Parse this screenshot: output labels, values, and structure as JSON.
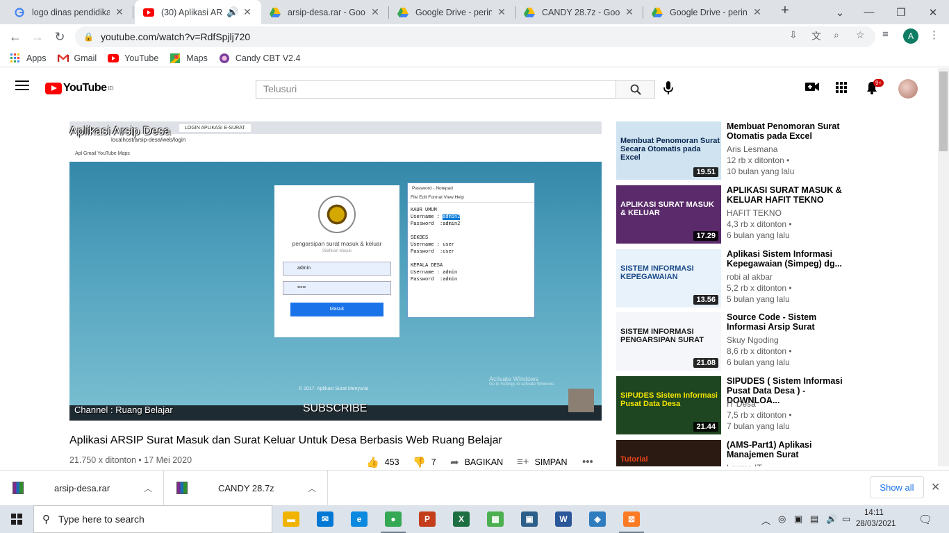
{
  "chrome": {
    "tabs": [
      {
        "title": "logo dinas pendidikan",
        "icon": "google-g-icon",
        "color": "#4285f4"
      },
      {
        "title": "(30) Aplikasi ARSIP",
        "icon": "youtube-icon",
        "color": "#ff0000",
        "active": true
      },
      {
        "title": "arsip-desa.rar - Google",
        "icon": "google-drive-icon",
        "color": "#fbbc04"
      },
      {
        "title": "Google Drive - peringk",
        "icon": "google-drive-icon",
        "color": "#fbbc04"
      },
      {
        "title": "CANDY 28.7z - Google",
        "icon": "google-drive-icon",
        "color": "#fbbc04"
      },
      {
        "title": "Google Drive - peringk",
        "icon": "google-drive-icon",
        "color": "#fbbc04"
      }
    ],
    "url": "youtube.com/watch?v=RdfSpjlj720",
    "profile_initial": "A",
    "bookmarks": [
      {
        "label": "Apps",
        "icon": "apps-grid-icon"
      },
      {
        "label": "Gmail",
        "icon": "gmail-icon"
      },
      {
        "label": "YouTube",
        "icon": "youtube-icon"
      },
      {
        "label": "Maps",
        "icon": "maps-icon"
      },
      {
        "label": "Candy CBT V2.4",
        "icon": "candy-icon"
      }
    ]
  },
  "youtube": {
    "logo_text": "YouTube",
    "logo_region": "ID",
    "search_placeholder": "Telusuri",
    "notif_count": "9+"
  },
  "player": {
    "overlay_title": "Aplikasi Arsip Desa",
    "inner_tab_title": "LOGIN APLIKASI E-SURAT",
    "inner_url": "localhost/arsip-desa/web/login",
    "inner_bookmarks": "Apl   Gmail   YouTube   Maps",
    "login_heading": "pengarsipan surat masuk & keluar",
    "login_sub": "Silahkan Masuk",
    "login_user": "admin",
    "login_pass": "•••••",
    "login_button": "Masuk",
    "notepad_title": "Password - Notepad",
    "notepad_menu": "File   Edit   Format   View   Help",
    "notepad_lines_before": "KAUR UMUM\nUsername : ",
    "notepad_highlight": "admin2",
    "notepad_lines_after": "\nPassword  :admin2\n\nSEKDES\nUsername : user\nPassword  :user\n\nKEPALA DESA\nUsername : admin\nPassword  :admin",
    "footer": "© 2017. Aplikasi Surat Menyurat",
    "activate_title": "Activate Windows",
    "activate_sub": "Go to Settings to activate Windows.",
    "channel": "Channel : Ruang Belajar",
    "subscribe": "SUBSCRIBE"
  },
  "video": {
    "title": "Aplikasi ARSIP Surat Masuk dan Surat Keluar Untuk Desa Berbasis Web Ruang Belajar",
    "meta": "21.750 x ditonton • 17 Mei 2020",
    "likes": "453",
    "dislikes": "7",
    "share": "BAGIKAN",
    "save": "SIMPAN"
  },
  "recommendations": [
    {
      "title": "Membuat Penomoran Surat Otomatis pada Excel",
      "channel": "Aris Lesmana",
      "views": "12 rb x ditonton •",
      "age": "10 bulan yang lalu",
      "duration": "19.51",
      "thumb_text": "Membuat Penomoran Surat Secara Otomatis pada Excel",
      "thumb_bg": "#cfe3f0",
      "thumb_fg": "#0d2a55"
    },
    {
      "title": "APLIKASI SURAT MASUK & KELUAR HAFIT TEKNO",
      "channel": "HAFIT TEKNO",
      "views": "4,3 rb x ditonton •",
      "age": "6 bulan yang lalu",
      "duration": "17.29",
      "thumb_text": "APLIKASI SURAT MASUK & KELUAR",
      "thumb_bg": "#5a2a6a",
      "thumb_fg": "#ffffff"
    },
    {
      "title": "Aplikasi Sistem Informasi Kepegawaian (Simpeg) dg...",
      "channel": "robi al akbar",
      "views": "5,2 rb x ditonton •",
      "age": "5 bulan yang lalu",
      "duration": "13.56",
      "thumb_text": "SISTEM INFORMASI KEPEGAWAIAN",
      "thumb_bg": "#e8f2fa",
      "thumb_fg": "#1a4a8a"
    },
    {
      "title": "Source Code - Sistem Informasi Arsip Surat",
      "channel": "Skuy Ngoding",
      "views": "8,6 rb x ditonton •",
      "age": "6 bulan yang lalu",
      "duration": "21.08",
      "thumb_text": "SISTEM INFORMASI PENGARSIPAN SURAT",
      "thumb_bg": "#f4f6fa",
      "thumb_fg": "#1b1b1b"
    },
    {
      "title": "SIPUDES ( Sistem Informasi Pusat Data Desa ) - DOWNLOA...",
      "channel": "IT Desa",
      "views": "7,5 rb x ditonton •",
      "age": "7 bulan yang lalu",
      "duration": "21.44",
      "thumb_text": "SIPUDES Sistem Informasi Pusat Data Desa",
      "thumb_bg": "#1e4620",
      "thumb_fg": "#f5e400"
    },
    {
      "title": "(AMS-Part1) Aplikasi Manajemen Surat",
      "channel": "Lauma IT",
      "views": "",
      "age": "",
      "duration": "",
      "thumb_text": "Tutorial",
      "thumb_bg": "#2b1a12",
      "thumb_fg": "#e8431a"
    }
  ],
  "downloads": {
    "items": [
      {
        "name": "arsip-desa.rar"
      },
      {
        "name": "CANDY 28.7z"
      }
    ],
    "show_all": "Show all"
  },
  "taskbar": {
    "search_placeholder": "Type here to search",
    "time": "14:11",
    "date": "28/03/2021",
    "apps": [
      {
        "icon": "file-explorer-icon",
        "color": "#f0b400",
        "glyph": "▬"
      },
      {
        "icon": "mail-icon",
        "color": "#0078d4",
        "glyph": "✉"
      },
      {
        "icon": "edge-icon",
        "color": "#0c8ae0",
        "glyph": "e"
      },
      {
        "icon": "chrome-icon",
        "color": "#34a853",
        "glyph": "●",
        "open": true
      },
      {
        "icon": "powerpoint-icon",
        "color": "#c43e1c",
        "glyph": "P"
      },
      {
        "icon": "excel-icon",
        "color": "#1d6f42",
        "glyph": "X"
      },
      {
        "icon": "spreadsheet-icon",
        "color": "#4caf50",
        "glyph": "▦"
      },
      {
        "icon": "photos-icon",
        "color": "#2c5f8a",
        "glyph": "▣"
      },
      {
        "icon": "word-icon",
        "color": "#2b579a",
        "glyph": "W"
      },
      {
        "icon": "virtualbox-icon",
        "color": "#2f7dbf",
        "glyph": "◈"
      },
      {
        "icon": "xampp-icon",
        "color": "#fb7a24",
        "glyph": "⊠",
        "open": true
      }
    ]
  }
}
